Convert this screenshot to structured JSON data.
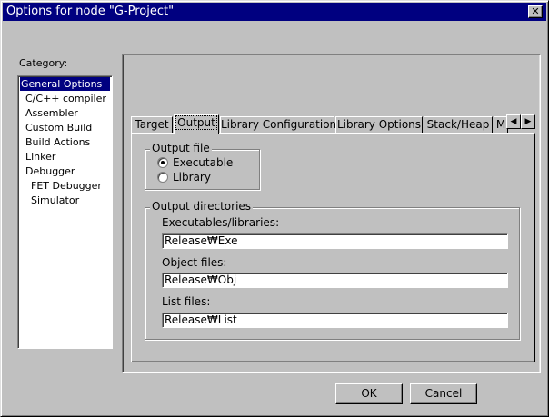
{
  "window": {
    "title": "Options for node \"G-Project\"",
    "close_glyph": "✕"
  },
  "category": {
    "label": "Category:",
    "items": [
      {
        "label": "General Options",
        "selected": true
      },
      {
        "label": "C/C++ compiler"
      },
      {
        "label": "Assembler"
      },
      {
        "label": "Custom Build"
      },
      {
        "label": "Build Actions"
      },
      {
        "label": "Linker"
      },
      {
        "label": "Debugger"
      },
      {
        "label": "FET Debugger"
      },
      {
        "label": "Simulator"
      }
    ]
  },
  "tabs": [
    {
      "label": "Target"
    },
    {
      "label": "Output",
      "active": true
    },
    {
      "label": "Library Configuration"
    },
    {
      "label": "Library Options"
    },
    {
      "label": "Stack/Heap"
    },
    {
      "label": "M"
    }
  ],
  "tab_scroll": {
    "left": "◀",
    "right": "▶"
  },
  "output_file": {
    "group_label": "Output file",
    "options": [
      {
        "label": "Executable",
        "checked": true
      },
      {
        "label": "Library",
        "checked": false
      }
    ]
  },
  "output_dirs": {
    "group_label": "Output directories",
    "fields": [
      {
        "label": "Executables/libraries:",
        "value": "Release₩Exe"
      },
      {
        "label": "Object files:",
        "value": "Release₩Obj"
      },
      {
        "label": "List files:",
        "value": "Release₩List"
      }
    ]
  },
  "buttons": {
    "ok": "OK",
    "cancel": "Cancel"
  }
}
